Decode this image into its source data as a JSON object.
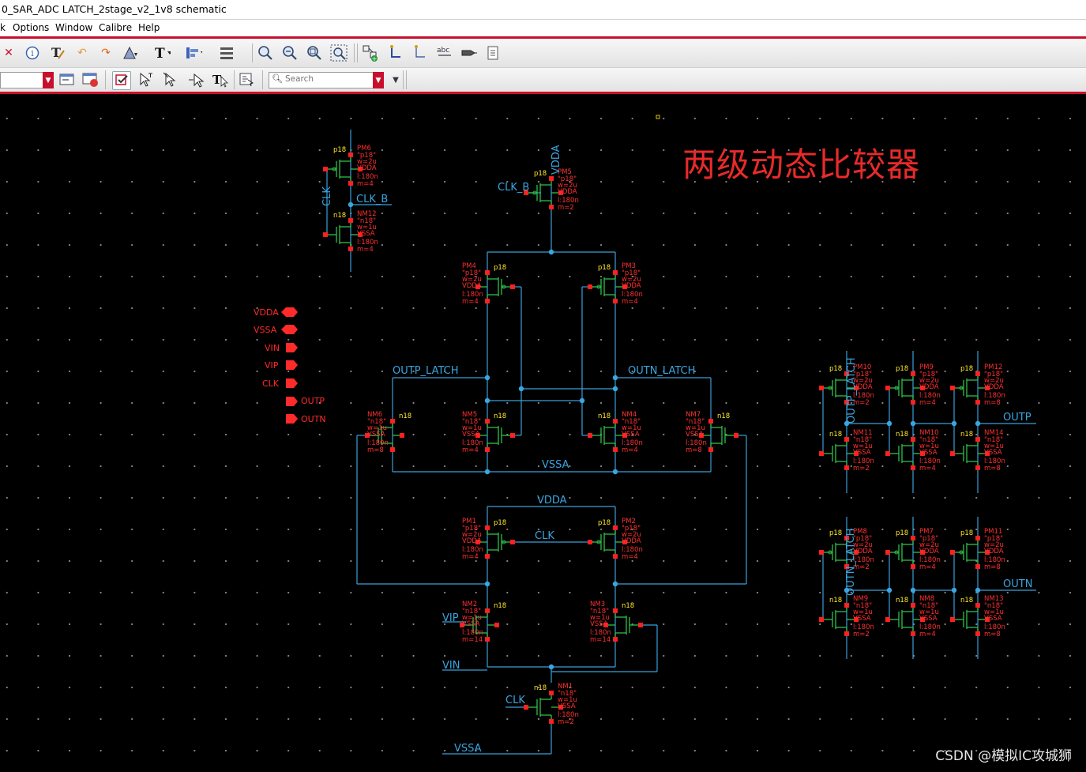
{
  "window": {
    "title": "0_SAR_ADC LATCH_2stage_v2_1v8 schematic"
  },
  "menu": {
    "items": [
      "k",
      "Options",
      "Window",
      "Calibre",
      "Help"
    ]
  },
  "toolbar1": {
    "icons": [
      "close-icon",
      "info-icon",
      "text-cursor-icon",
      "undo-icon",
      "redo-icon",
      "stretch-icon",
      "text-tool-icon",
      "align-icon",
      "distribute-icon",
      "zoom-in-icon",
      "zoom-out-icon",
      "zoom-fit-icon",
      "zoom-select-icon",
      "add-instance-icon",
      "wire-icon",
      "wire-narrow-icon",
      "label-abc-icon",
      "pin-icon",
      "properties-icon"
    ]
  },
  "toolbar2": {
    "icons": [
      "window-list-icon",
      "window-settings-icon",
      "select-mode-icon",
      "select-area-icon",
      "select-pointer-icon",
      "select-drag-icon",
      "text-select-icon",
      "hierarchy-icon"
    ]
  },
  "search": {
    "placeholder": "Search"
  },
  "colors": {
    "wire": "#3a9fd8",
    "device": "#2fc04a",
    "label": "#ff3030",
    "param": "#ffea2a",
    "pin": "#ff2a2a",
    "background": "#000000",
    "accent": "#c8102e"
  },
  "annotation": {
    "title": "两级动态比较器"
  },
  "watermark": "CSDN @模拟IC攻城狮",
  "pins": [
    {
      "name": "VDDA",
      "dir": "inout"
    },
    {
      "name": "VSSA",
      "dir": "inout"
    },
    {
      "name": "VIN",
      "dir": "input"
    },
    {
      "name": "VIP",
      "dir": "input"
    },
    {
      "name": "CLK",
      "dir": "input"
    },
    {
      "name": "OUTP",
      "dir": "output"
    },
    {
      "name": "OUTN",
      "dir": "output"
    }
  ],
  "nets": {
    "vdda_top": "VDDA",
    "clk_b_gate": "CLK_B",
    "clk_inv_in": "CLK",
    "clk_inv_out": "CLK_B",
    "outp_latch": "OUTP_LATCH",
    "outn_latch": "OUTN_LATCH",
    "vssa_mid": "VSSA",
    "vdda_mid": "VDDA",
    "clk_mid": "CLK",
    "vip": "VIP",
    "vin": "VIN",
    "clk_bot": "CLK",
    "vssa_bot": "VSSA",
    "outp_latch_buf": "OUTP_LATCH",
    "outn_latch_buf": "OUTN_LATCH",
    "outp": "OUTP",
    "outn": "OUTN"
  },
  "devices": [
    {
      "model": "p18",
      "name": "PM6",
      "cell": "\"p18\"",
      "p1": "w=2u",
      "l": "l:180n",
      "m": "m=4",
      "tap": "VDDA"
    },
    {
      "model": "n18",
      "name": "NM12",
      "cell": "\"n18\"",
      "p1": "w=1u",
      "l": "l:180n",
      "m": "m=4",
      "tap": "VSSA"
    },
    {
      "model": "p18",
      "name": "PM5",
      "cell": "\"p18\"",
      "p1": "w=2u",
      "l": "l:180n",
      "m": "m=2",
      "tap": "VDDA"
    },
    {
      "model": "p18",
      "name": "PM4",
      "cell": "\"p18\"",
      "p1": "w=2u",
      "l": "l:180n",
      "m": "m=4",
      "tap": "VDDA"
    },
    {
      "model": "p18",
      "name": "PM3",
      "cell": "\"p18\"",
      "p1": "w=2u",
      "l": "l:180n",
      "m": "m=4",
      "tap": "VDDA"
    },
    {
      "model": "n18",
      "name": "NM6",
      "cell": "\"n18\"",
      "p1": "w=1u",
      "l": "l:180n",
      "m": "m=8",
      "tap": "VSSA"
    },
    {
      "model": "n18",
      "name": "NM5",
      "cell": "\"n18\"",
      "p1": "w=1u",
      "l": "l:180n",
      "m": "m=4",
      "tap": "VSSA"
    },
    {
      "model": "n18",
      "name": "NM4",
      "cell": "\"n18\"",
      "p1": "w=1u",
      "l": "l:180n",
      "m": "m=4",
      "tap": "VSSA"
    },
    {
      "model": "n18",
      "name": "NM7",
      "cell": "\"n18\"",
      "p1": "w=1u",
      "l": "l:180n",
      "m": "m=8",
      "tap": "VSSA"
    },
    {
      "model": "p18",
      "name": "PM1",
      "cell": "\"p18\"",
      "p1": "w=2u",
      "l": "l:180n",
      "m": "m=4",
      "tap": "VDDA"
    },
    {
      "model": "p18",
      "name": "PM2",
      "cell": "\"p18\"",
      "p1": "w=2u",
      "l": "l:180n",
      "m": "m=4",
      "tap": "VDDA"
    },
    {
      "model": "n18",
      "name": "NM2",
      "cell": "\"n18\"",
      "p1": "w=1u",
      "l": "l:180n",
      "m": "m=14",
      "tap": "VSSA"
    },
    {
      "model": "n18",
      "name": "NM3",
      "cell": "\"n18\"",
      "p1": "w=1u",
      "l": "l:180n",
      "m": "m=14",
      "tap": "VSSA"
    },
    {
      "model": "n18",
      "name": "NM1",
      "cell": "\"n18\"",
      "p1": "w=1u",
      "l": "l:180n",
      "m": "m=2",
      "tap": "VSSA"
    },
    {
      "model": "p18",
      "name": "PM10",
      "cell": "\"p18\"",
      "p1": "w=2u",
      "l": "l:180n",
      "m": "m=2",
      "tap": "VDDA"
    },
    {
      "model": "p18",
      "name": "PM9",
      "cell": "\"p18\"",
      "p1": "w=2u",
      "l": "l:180n",
      "m": "m=4",
      "tap": "VDDA"
    },
    {
      "model": "p18",
      "name": "PM12",
      "cell": "\"p18\"",
      "p1": "w=2u",
      "l": "l:180n",
      "m": "m=8",
      "tap": "VDDA"
    },
    {
      "model": "n18",
      "name": "NM11",
      "cell": "\"n18\"",
      "p1": "w=1u",
      "l": "l:180n",
      "m": "m=2",
      "tap": "VSSA"
    },
    {
      "model": "n18",
      "name": "NM10",
      "cell": "\"n18\"",
      "p1": "w=1u",
      "l": "l:180n",
      "m": "m=4",
      "tap": "VSSA"
    },
    {
      "model": "n18",
      "name": "NM14",
      "cell": "\"n18\"",
      "p1": "w=1u",
      "l": "l:180n",
      "m": "m=8",
      "tap": "VSSA"
    },
    {
      "model": "p18",
      "name": "PM8",
      "cell": "\"p18\"",
      "p1": "w=2u",
      "l": "l:180n",
      "m": "m=2",
      "tap": "VDDA"
    },
    {
      "model": "p18",
      "name": "PM7",
      "cell": "\"p18\"",
      "p1": "w=2u",
      "l": "l:180n",
      "m": "m=4",
      "tap": "VDDA"
    },
    {
      "model": "p18",
      "name": "PM11",
      "cell": "\"p18\"",
      "p1": "w=2u",
      "l": "l:180n",
      "m": "m=8",
      "tap": "VDDA"
    },
    {
      "model": "n18",
      "name": "NM9",
      "cell": "\"n18\"",
      "p1": "w=1u",
      "l": "l:180n",
      "m": "m=2",
      "tap": "VSSA"
    },
    {
      "model": "n18",
      "name": "NM8",
      "cell": "\"n18\"",
      "p1": "w=1u",
      "l": "l:180n",
      "m": "m=4",
      "tap": "VSSA"
    },
    {
      "model": "n18",
      "name": "NM13",
      "cell": "\"n18\"",
      "p1": "w=1u",
      "l": "l:180n",
      "m": "m=8",
      "tap": "VSSA"
    }
  ]
}
